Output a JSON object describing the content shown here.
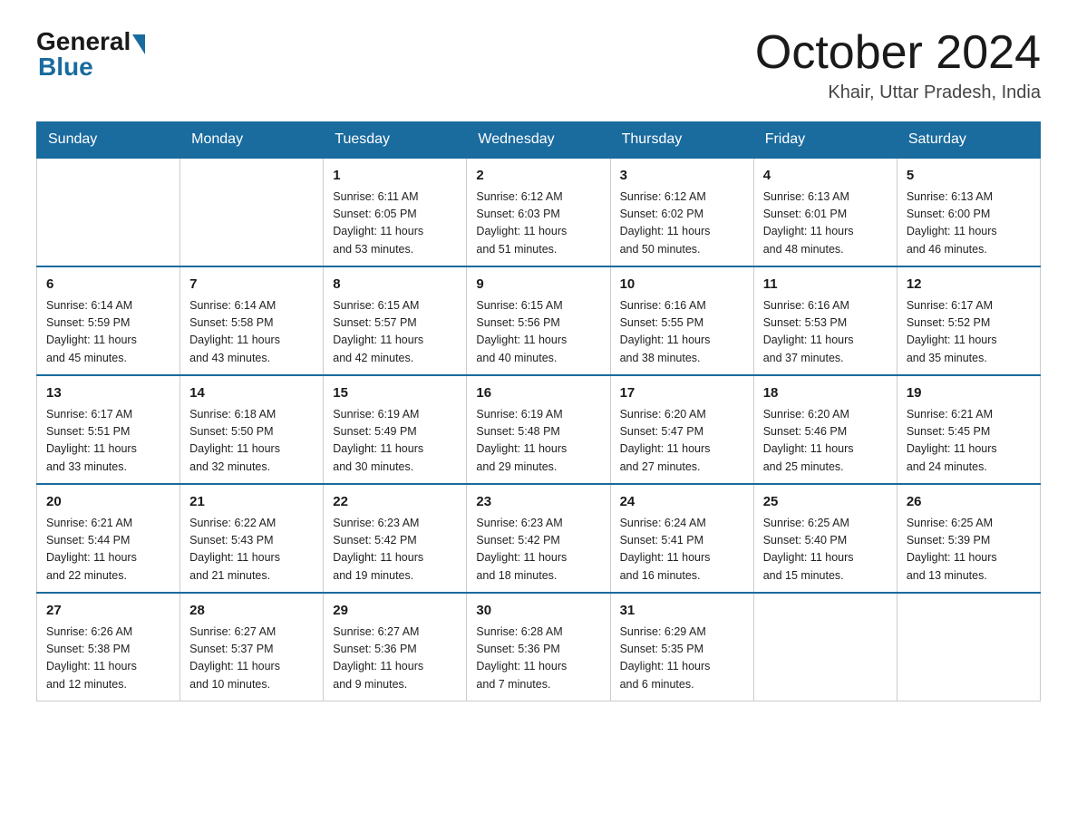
{
  "header": {
    "logo_general": "General",
    "logo_blue": "Blue",
    "title": "October 2024",
    "location": "Khair, Uttar Pradesh, India"
  },
  "days_of_week": [
    "Sunday",
    "Monday",
    "Tuesday",
    "Wednesday",
    "Thursday",
    "Friday",
    "Saturday"
  ],
  "weeks": [
    [
      {
        "day": "",
        "info": ""
      },
      {
        "day": "",
        "info": ""
      },
      {
        "day": "1",
        "info": "Sunrise: 6:11 AM\nSunset: 6:05 PM\nDaylight: 11 hours\nand 53 minutes."
      },
      {
        "day": "2",
        "info": "Sunrise: 6:12 AM\nSunset: 6:03 PM\nDaylight: 11 hours\nand 51 minutes."
      },
      {
        "day": "3",
        "info": "Sunrise: 6:12 AM\nSunset: 6:02 PM\nDaylight: 11 hours\nand 50 minutes."
      },
      {
        "day": "4",
        "info": "Sunrise: 6:13 AM\nSunset: 6:01 PM\nDaylight: 11 hours\nand 48 minutes."
      },
      {
        "day": "5",
        "info": "Sunrise: 6:13 AM\nSunset: 6:00 PM\nDaylight: 11 hours\nand 46 minutes."
      }
    ],
    [
      {
        "day": "6",
        "info": "Sunrise: 6:14 AM\nSunset: 5:59 PM\nDaylight: 11 hours\nand 45 minutes."
      },
      {
        "day": "7",
        "info": "Sunrise: 6:14 AM\nSunset: 5:58 PM\nDaylight: 11 hours\nand 43 minutes."
      },
      {
        "day": "8",
        "info": "Sunrise: 6:15 AM\nSunset: 5:57 PM\nDaylight: 11 hours\nand 42 minutes."
      },
      {
        "day": "9",
        "info": "Sunrise: 6:15 AM\nSunset: 5:56 PM\nDaylight: 11 hours\nand 40 minutes."
      },
      {
        "day": "10",
        "info": "Sunrise: 6:16 AM\nSunset: 5:55 PM\nDaylight: 11 hours\nand 38 minutes."
      },
      {
        "day": "11",
        "info": "Sunrise: 6:16 AM\nSunset: 5:53 PM\nDaylight: 11 hours\nand 37 minutes."
      },
      {
        "day": "12",
        "info": "Sunrise: 6:17 AM\nSunset: 5:52 PM\nDaylight: 11 hours\nand 35 minutes."
      }
    ],
    [
      {
        "day": "13",
        "info": "Sunrise: 6:17 AM\nSunset: 5:51 PM\nDaylight: 11 hours\nand 33 minutes."
      },
      {
        "day": "14",
        "info": "Sunrise: 6:18 AM\nSunset: 5:50 PM\nDaylight: 11 hours\nand 32 minutes."
      },
      {
        "day": "15",
        "info": "Sunrise: 6:19 AM\nSunset: 5:49 PM\nDaylight: 11 hours\nand 30 minutes."
      },
      {
        "day": "16",
        "info": "Sunrise: 6:19 AM\nSunset: 5:48 PM\nDaylight: 11 hours\nand 29 minutes."
      },
      {
        "day": "17",
        "info": "Sunrise: 6:20 AM\nSunset: 5:47 PM\nDaylight: 11 hours\nand 27 minutes."
      },
      {
        "day": "18",
        "info": "Sunrise: 6:20 AM\nSunset: 5:46 PM\nDaylight: 11 hours\nand 25 minutes."
      },
      {
        "day": "19",
        "info": "Sunrise: 6:21 AM\nSunset: 5:45 PM\nDaylight: 11 hours\nand 24 minutes."
      }
    ],
    [
      {
        "day": "20",
        "info": "Sunrise: 6:21 AM\nSunset: 5:44 PM\nDaylight: 11 hours\nand 22 minutes."
      },
      {
        "day": "21",
        "info": "Sunrise: 6:22 AM\nSunset: 5:43 PM\nDaylight: 11 hours\nand 21 minutes."
      },
      {
        "day": "22",
        "info": "Sunrise: 6:23 AM\nSunset: 5:42 PM\nDaylight: 11 hours\nand 19 minutes."
      },
      {
        "day": "23",
        "info": "Sunrise: 6:23 AM\nSunset: 5:42 PM\nDaylight: 11 hours\nand 18 minutes."
      },
      {
        "day": "24",
        "info": "Sunrise: 6:24 AM\nSunset: 5:41 PM\nDaylight: 11 hours\nand 16 minutes."
      },
      {
        "day": "25",
        "info": "Sunrise: 6:25 AM\nSunset: 5:40 PM\nDaylight: 11 hours\nand 15 minutes."
      },
      {
        "day": "26",
        "info": "Sunrise: 6:25 AM\nSunset: 5:39 PM\nDaylight: 11 hours\nand 13 minutes."
      }
    ],
    [
      {
        "day": "27",
        "info": "Sunrise: 6:26 AM\nSunset: 5:38 PM\nDaylight: 11 hours\nand 12 minutes."
      },
      {
        "day": "28",
        "info": "Sunrise: 6:27 AM\nSunset: 5:37 PM\nDaylight: 11 hours\nand 10 minutes."
      },
      {
        "day": "29",
        "info": "Sunrise: 6:27 AM\nSunset: 5:36 PM\nDaylight: 11 hours\nand 9 minutes."
      },
      {
        "day": "30",
        "info": "Sunrise: 6:28 AM\nSunset: 5:36 PM\nDaylight: 11 hours\nand 7 minutes."
      },
      {
        "day": "31",
        "info": "Sunrise: 6:29 AM\nSunset: 5:35 PM\nDaylight: 11 hours\nand 6 minutes."
      },
      {
        "day": "",
        "info": ""
      },
      {
        "day": "",
        "info": ""
      }
    ]
  ]
}
